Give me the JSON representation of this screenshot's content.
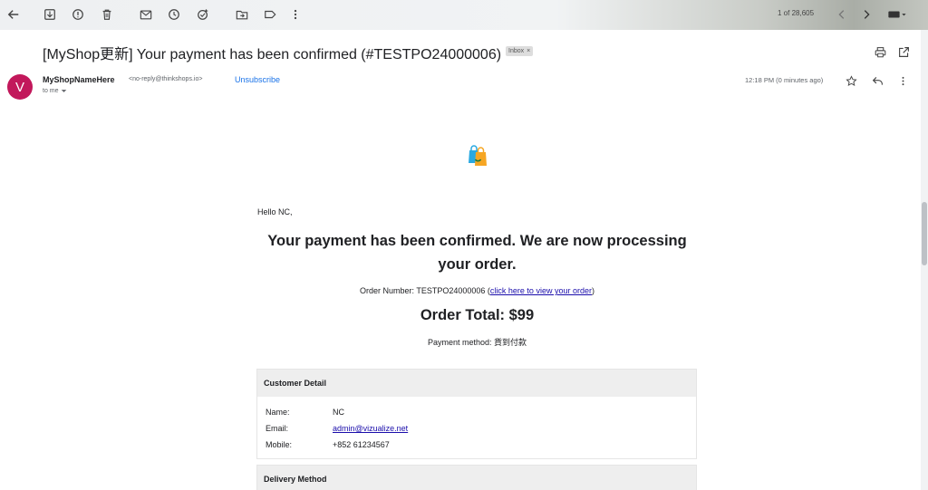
{
  "toolbar": {
    "counter": "1 of 28,605",
    "icons": [
      "back-arrow-icon",
      "archive-icon",
      "report-spam-icon",
      "delete-icon",
      "mark-unread-icon",
      "snooze-icon",
      "add-task-icon",
      "move-to-icon",
      "label-icon",
      "more-vert-icon",
      "prev-icon",
      "next-icon",
      "keyboard-icon"
    ]
  },
  "email": {
    "subject": "[MyShop更新] Your payment has been confirmed (#TESTPO24000006)",
    "badge": "Inbox",
    "badge_close": "×",
    "avatar_letter": "V",
    "sender_name": "MyShopNameHere",
    "sender_address": "<no-reply@thinkshops.io>",
    "unsubscribe": "Unsubscribe",
    "to_me": "to me",
    "timestamp": "12:18 PM (0 minutes ago)"
  },
  "body": {
    "greeting": "Hello NC,",
    "headline": "Your payment has been confirmed. We are now processing your order.",
    "order_number_label": "Order Number: TESTPO24000006 (",
    "order_link": "click here to view your order",
    "order_number_close": ")",
    "order_total": "Order Total: $99",
    "payment_method": "Payment method: 貨到付款",
    "customer_detail": {
      "title": "Customer Detail",
      "name_label": "Name:",
      "name_value": "NC",
      "email_label": "Email:",
      "email_value": "admin@vizualize.net",
      "mobile_label": "Mobile:",
      "mobile_value": "+852 61234567"
    },
    "delivery_method": {
      "title": "Delivery Method"
    }
  },
  "colors": {
    "avatar": "#c2185b",
    "link": "#1a0dab",
    "unsubscribe": "#1a73e8"
  }
}
